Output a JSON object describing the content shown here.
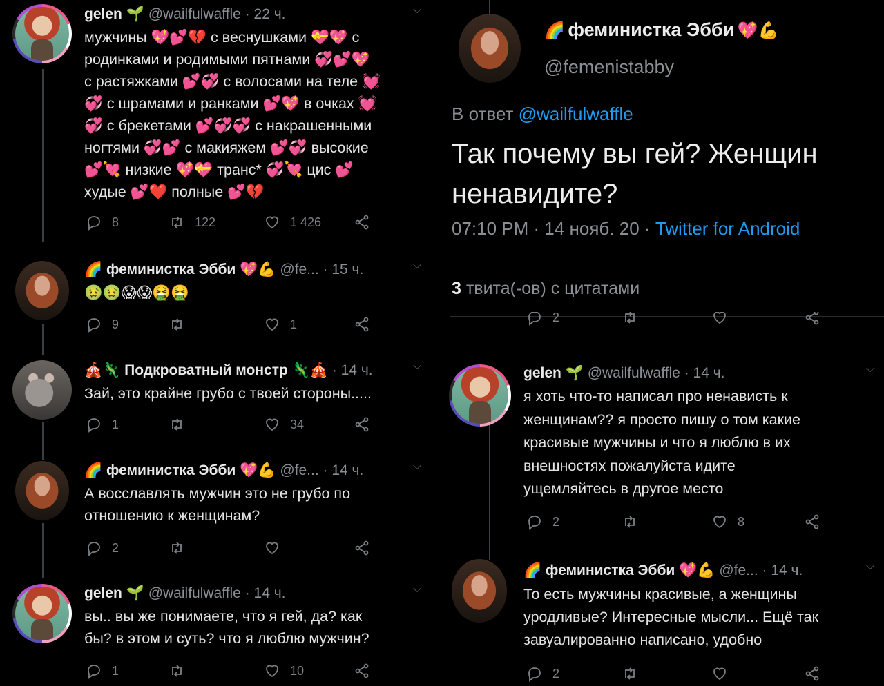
{
  "left": {
    "tweets": [
      {
        "name": "gelen",
        "name_icon": "🌱",
        "handle": "@wailfulwaffle",
        "time": "· 22 ч.",
        "lines": [
          "мужчины 💖💕💔 с веснушками 💝💖 с",
          "родинками и родимыми пятнами 💞💕💖",
          "с растяжками 💕💞 с волосами на теле 💓",
          "💞 с шрамами и ранками 💕💖 в очках 💓",
          "💞 с брекетами 💕💞💞 с накрашенными",
          "ногтями 💞💕 с макияжем 💕💞 высокие",
          "💕💘 низкие 💖💝 транс* 💞💘 цис 💕",
          "худые 💕❤️ полные 💕💔"
        ],
        "replies": "8",
        "retweets": "122",
        "likes": "1 426"
      },
      {
        "name": "феминистка Эбби",
        "name_prefix": "🌈",
        "name_suffix": "💖💪",
        "handle": "@fe...",
        "time": "· 15 ч.",
        "lines": [
          "🤢🤢😱😱🤮🤮"
        ],
        "replies": "9",
        "retweets": "",
        "likes": "1"
      },
      {
        "name": "Подкроватный монстр",
        "name_prefix": "🎪🦎",
        "name_suffix": "🦎🎪",
        "handle": "",
        "time": "· 14 ч.",
        "lines": [
          "Зай, это крайне грубо с твоей стороны....."
        ],
        "replies": "1",
        "retweets": "",
        "likes": "34"
      },
      {
        "name": "феминистка Эбби",
        "name_prefix": "🌈",
        "name_suffix": "💖💪",
        "handle": "@fe...",
        "time": "· 14 ч.",
        "lines": [
          "А восславлять мужчин это не грубо по",
          "отношению к женщинам?"
        ],
        "replies": "2",
        "retweets": "",
        "likes": ""
      },
      {
        "name": "gelen",
        "name_icon": "🌱",
        "handle": "@wailfulwaffle",
        "time": "· 14 ч.",
        "lines": [
          "вы.. вы же понимаете, что я гей, да? как",
          "бы? в этом и суть? что я люблю мужчин?"
        ],
        "replies": "1",
        "retweets": "",
        "likes": "10"
      }
    ]
  },
  "right": {
    "main": {
      "name": "феминистка Эбби",
      "name_prefix": "🌈",
      "name_suffix": "💖💪",
      "handle": "@femenistabby",
      "reply_prefix": "В ответ",
      "reply_to": "@wailfulwaffle",
      "text_lines": [
        "Так почему вы гей? Женщин",
        "ненавидите?"
      ],
      "timestamp": "07:10 PM · 14 нояб. 20 ·",
      "source": "Twitter for Android",
      "quotes_count": "3",
      "quotes_label": "твита(-ов) с цитатами",
      "cut_reply_count": "2"
    },
    "tweets": [
      {
        "name": "gelen",
        "name_icon": "🌱",
        "handle": "@wailfulwaffle",
        "time": "· 14 ч.",
        "lines": [
          "я хоть что-то написал про ненависть к",
          "женщинам?? я просто пишу о том какие",
          "красивые мужчины и что я люблю в их",
          "внешностях пожалуйста идите",
          "ущемляйтесь в другое место"
        ],
        "replies": "2",
        "retweets": "",
        "likes": "8"
      },
      {
        "name": "феминистка Эбби",
        "name_prefix": "🌈",
        "name_suffix": "💖💪",
        "handle": "@fe...",
        "time": "· 14 ч.",
        "lines": [
          "То есть мужчины красивые, а женщины",
          "уродливые? Интересные мысли... Ещё так",
          "завуалированно написано, удобно"
        ],
        "replies": "2",
        "retweets": "",
        "likes": ""
      }
    ]
  },
  "colors": {
    "background": "#000000",
    "text": "#e3e3e3",
    "muted": "#8a8f94",
    "link": "#1d9bf0",
    "thread": "#3a3f44"
  },
  "icons": [
    "reply-icon",
    "retweet-icon",
    "like-icon",
    "share-icon",
    "chevron-down-icon"
  ]
}
